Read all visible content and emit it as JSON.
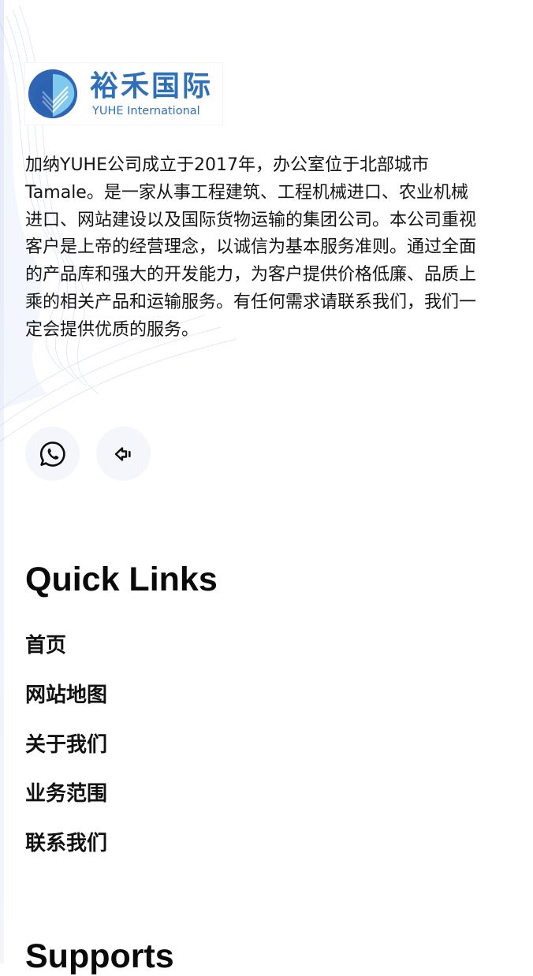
{
  "brand": {
    "name_cn": "裕禾国际",
    "name_en": "YUHE International",
    "logo_color": "#2d6fb8"
  },
  "intro": {
    "text": "加纳YUHE公司成立于2017年，办公室位于北部城市Tamale。是一家从事工程建筑、工程机械进口、农业机械进口、网站建设以及国际货物运输的集团公司。本公司重视客户是上帝的经营理念，以诚信为基本服务准则。通过全面的产品库和强大的开发能力，为客户提供价格低廉、品质上乘的相关产品和运输服务。有任何需求请联系我们，我们一定会提供优质的服务。"
  },
  "social": [
    {
      "icon": "whatsapp-icon"
    },
    {
      "icon": "share-icon"
    }
  ],
  "quick_links": {
    "title": "Quick Links",
    "items": [
      {
        "label": "首页"
      },
      {
        "label": "网站地图"
      },
      {
        "label": "关于我们"
      },
      {
        "label": "业务范围"
      },
      {
        "label": "联系我们"
      }
    ]
  },
  "supports": {
    "title": "Supports"
  },
  "colors": {
    "social_bg": "#f4f6fc",
    "text": "#111111"
  }
}
